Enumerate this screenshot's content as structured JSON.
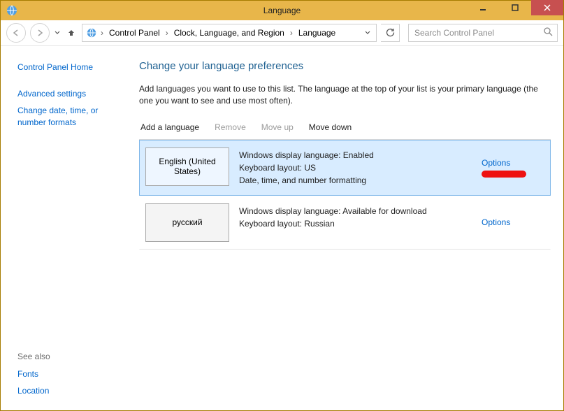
{
  "window": {
    "title": "Language"
  },
  "breadcrumb": {
    "items": [
      "Control Panel",
      "Clock, Language, and Region",
      "Language"
    ]
  },
  "search": {
    "placeholder": "Search Control Panel"
  },
  "sidebar": {
    "home": "Control Panel Home",
    "links": [
      "Advanced settings",
      "Change date, time, or number formats"
    ],
    "see_also_label": "See also",
    "see_also": [
      "Fonts",
      "Location"
    ]
  },
  "content": {
    "heading": "Change your language preferences",
    "description": "Add languages you want to use to this list. The language at the top of your list is your primary language (the one you want to see and use most often)."
  },
  "toolbar": {
    "add": "Add a language",
    "remove": "Remove",
    "move_up": "Move up",
    "move_down": "Move down"
  },
  "languages": [
    {
      "name": "English (United States)",
      "detail1": "Windows display language: Enabled",
      "detail2": "Keyboard layout: US",
      "detail3": "Date, time, and number formatting",
      "options_label": "Options",
      "selected": true,
      "redacted": true
    },
    {
      "name": "русский",
      "detail1": "Windows display language: Available for download",
      "detail2": "Keyboard layout: Russian",
      "detail3": "",
      "options_label": "Options",
      "selected": false,
      "redacted": false
    }
  ]
}
